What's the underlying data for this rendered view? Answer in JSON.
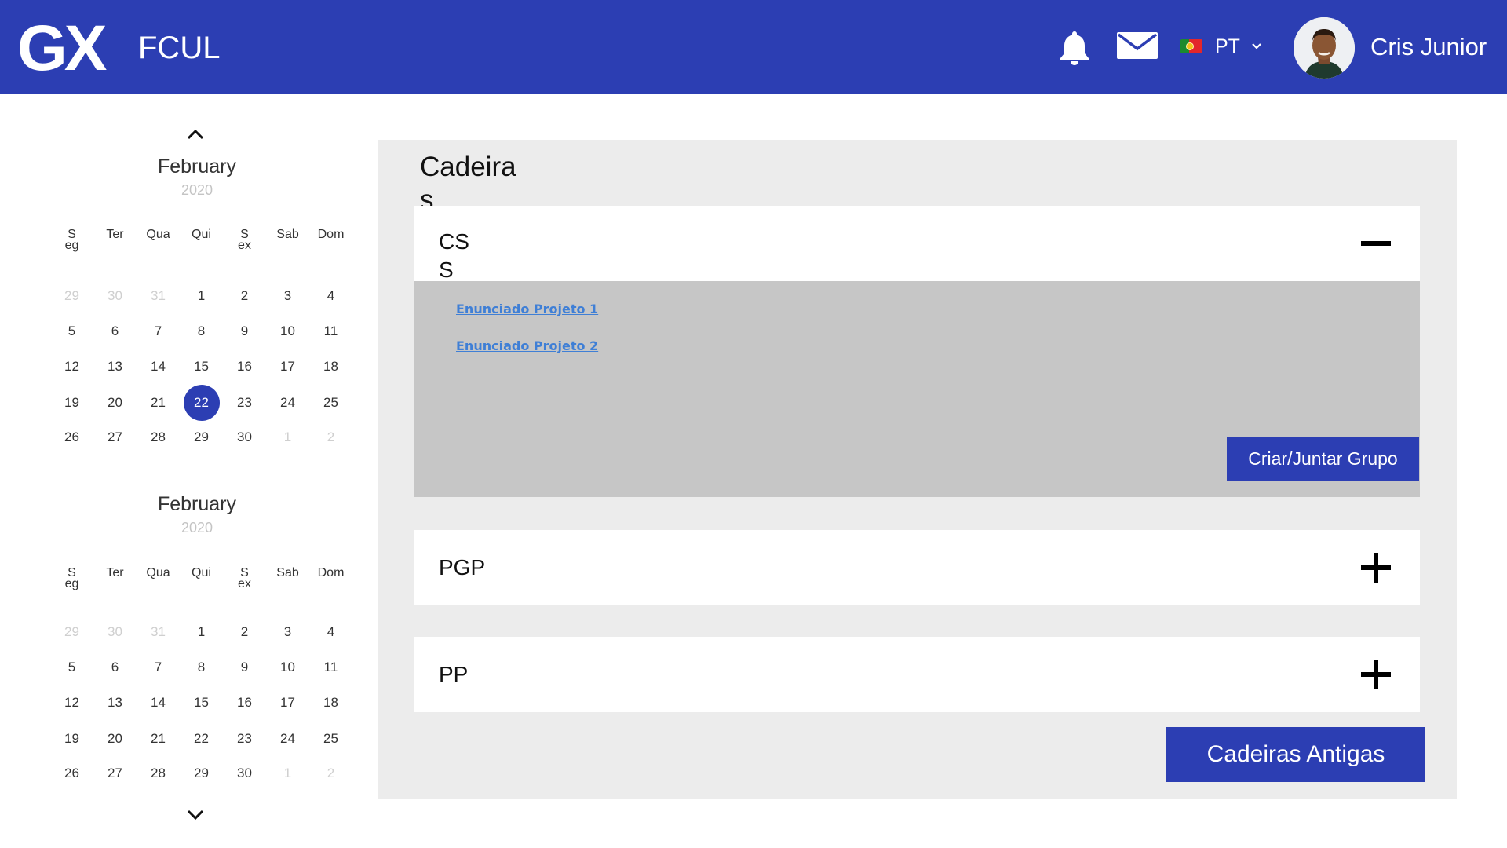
{
  "header": {
    "logo": "GX",
    "org": "FCUL",
    "icons": {
      "notifications": "bell-icon",
      "messages": "mail-icon",
      "language_flag": "portugal-flag-icon",
      "dropdown": "chevron-down-icon"
    },
    "language": "PT",
    "user_name": "Cris Junior",
    "colors": {
      "bar": "#2c3eb3",
      "text": "#ffffff"
    }
  },
  "calendars": [
    {
      "month": "February",
      "year": "2020",
      "weekdays": [
        "Seg",
        "Ter",
        "Qua",
        "Qui",
        "Sex",
        "Sab",
        "Dom"
      ],
      "weeks": [
        [
          "29",
          "30",
          "31",
          "1",
          "2",
          "3",
          "4"
        ],
        [
          "5",
          "6",
          "7",
          "8",
          "9",
          "10",
          "11"
        ],
        [
          "12",
          "13",
          "14",
          "15",
          "16",
          "17",
          "18"
        ],
        [
          "19",
          "20",
          "21",
          "22",
          "23",
          "24",
          "25"
        ],
        [
          "26",
          "27",
          "28",
          "29",
          "30",
          "1",
          "2"
        ]
      ],
      "selected_day": "22"
    },
    {
      "month": "February",
      "year": "2020",
      "weekdays": [
        "Seg",
        "Ter",
        "Qua",
        "Qui",
        "Sex",
        "Sab",
        "Dom"
      ],
      "weeks": [
        [
          "29",
          "30",
          "31",
          "1",
          "2",
          "3",
          "4"
        ],
        [
          "5",
          "6",
          "7",
          "8",
          "9",
          "10",
          "11"
        ],
        [
          "12",
          "13",
          "14",
          "15",
          "16",
          "17",
          "18"
        ],
        [
          "19",
          "20",
          "21",
          "22",
          "23",
          "24",
          "25"
        ],
        [
          "26",
          "27",
          "28",
          "29",
          "30",
          "1",
          "2"
        ]
      ],
      "selected_day": ""
    }
  ],
  "calendar_nav": {
    "up": "chevron-up-icon",
    "down": "chevron-down-icon"
  },
  "main": {
    "title": "Cadeiras",
    "courses": [
      {
        "name": "CSS",
        "expanded": true,
        "toggle_icon": "minus-icon",
        "documents": [
          "Enunciado Projeto 1",
          "Enunciado Projeto 2"
        ],
        "action": "Criar/Juntar Grupo"
      },
      {
        "name": "PGP",
        "expanded": false,
        "toggle_icon": "plus-icon"
      },
      {
        "name": "PP",
        "expanded": false,
        "toggle_icon": "plus-icon"
      }
    ],
    "old_courses_button": "Cadeiras Antigas",
    "colors": {
      "panel": "#ececec",
      "expanded_body": "#c6c6c6",
      "accent": "#2c3eb3",
      "link": "#3f7fd6"
    }
  }
}
